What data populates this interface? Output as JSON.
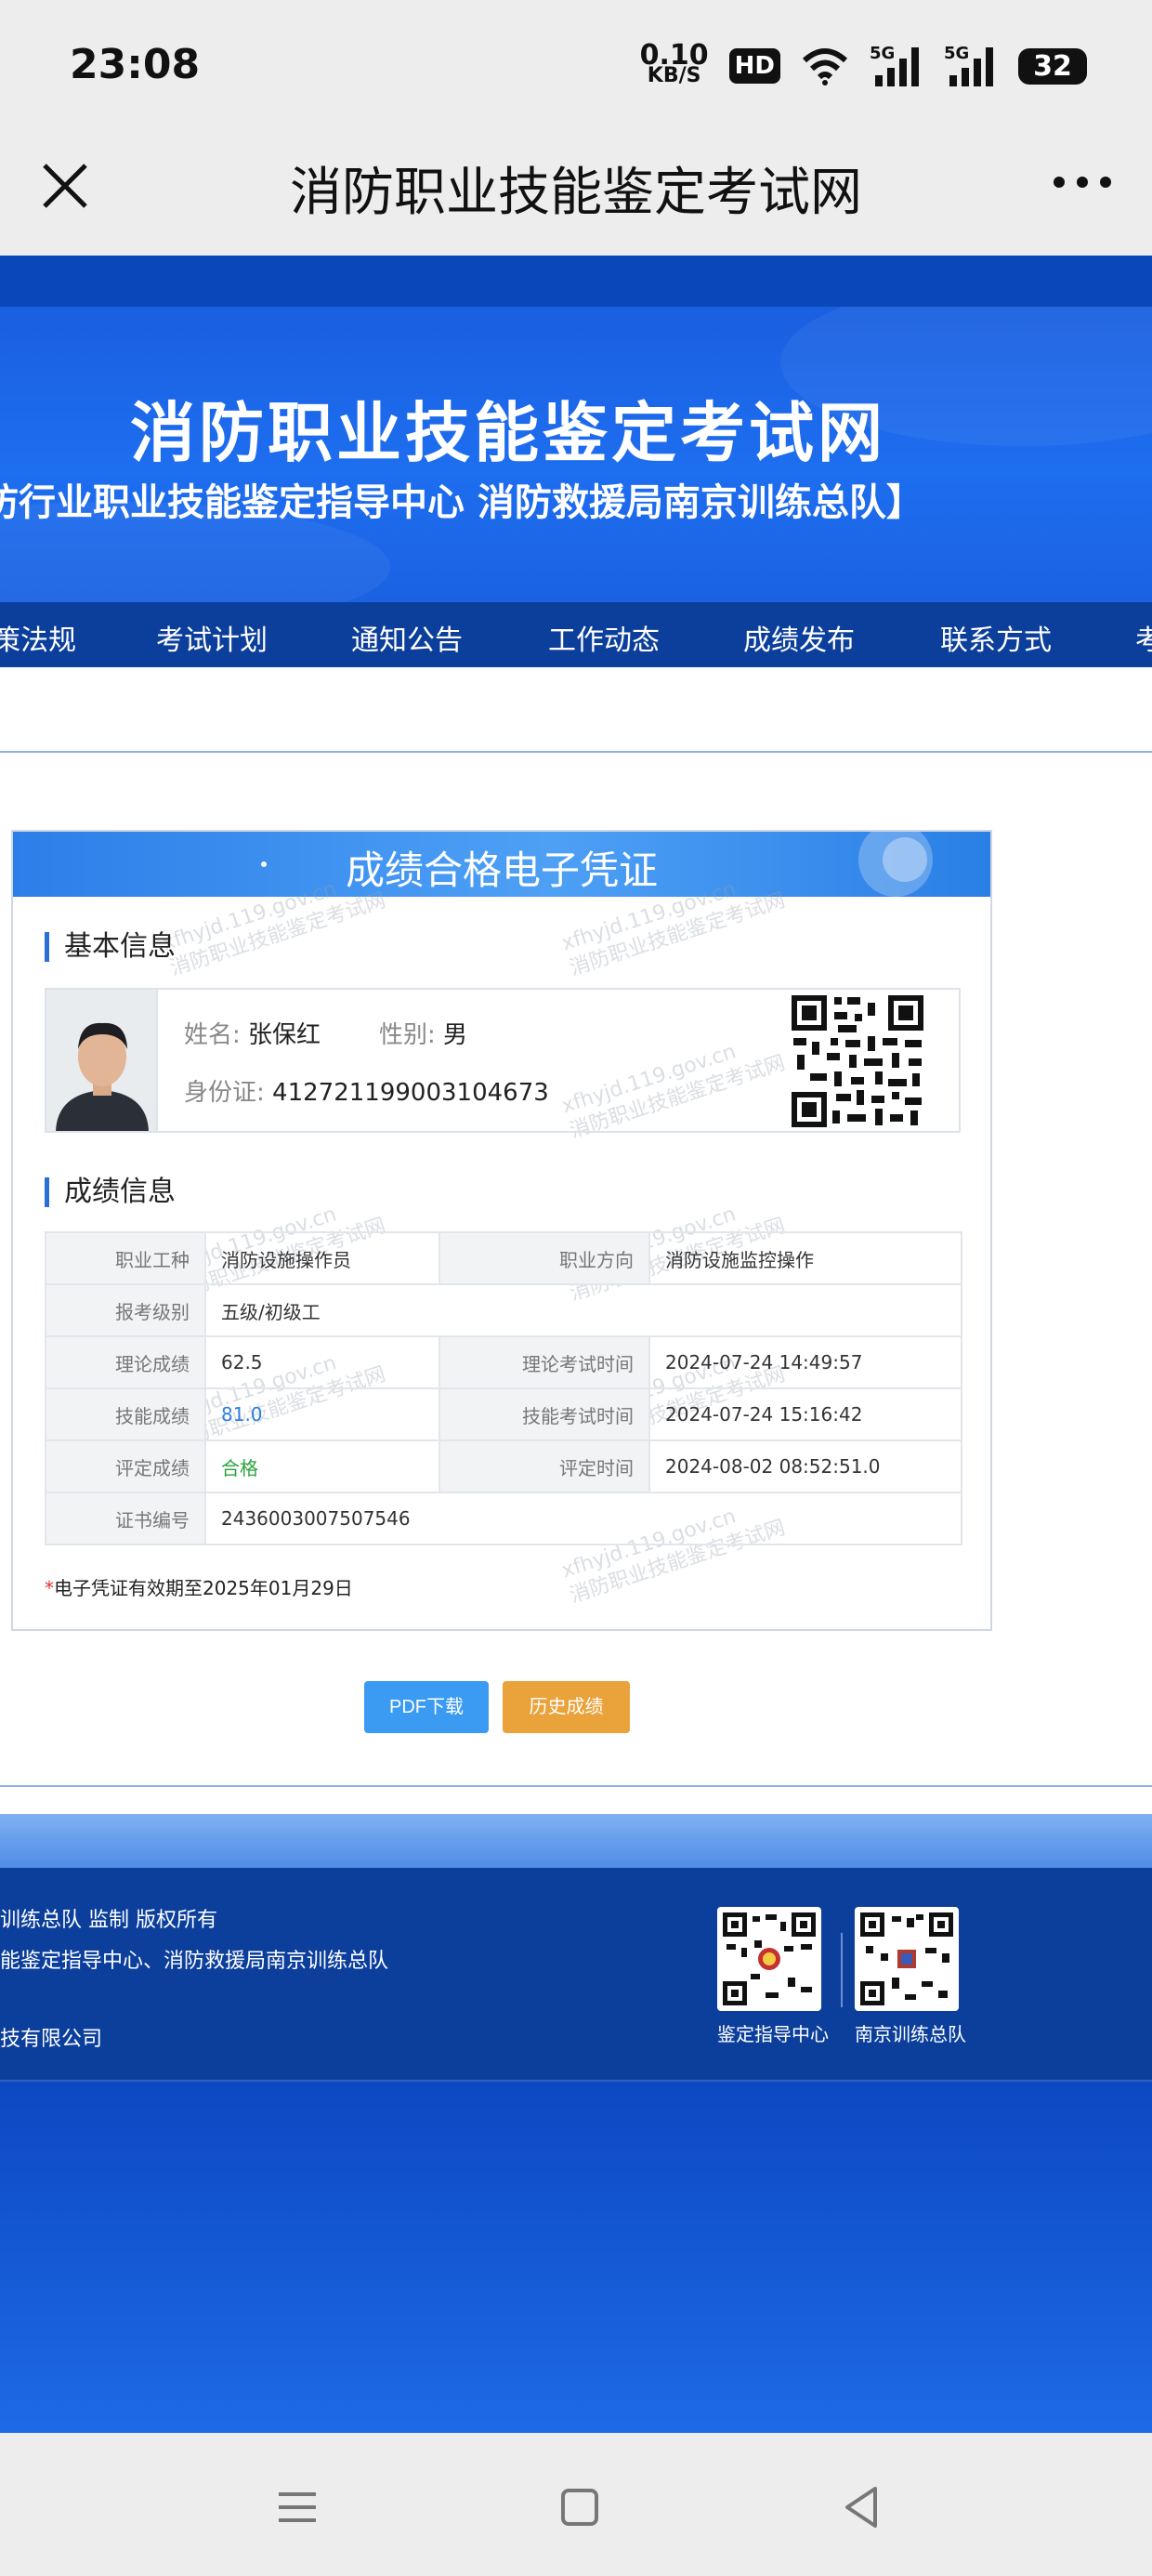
{
  "status_bar": {
    "time": "23:08",
    "net_speed_value": "0.10",
    "net_speed_unit": "KB/S",
    "hd_label": "HD",
    "signal1_label": "5G",
    "signal2_label": "5G",
    "battery": "32"
  },
  "title_bar": {
    "title": "消防职业技能鉴定考试网",
    "close_icon": "close-icon",
    "more_icon": "more-icon"
  },
  "banner": {
    "title": "消防职业技能鉴定考试网",
    "subtitle": "防行业职业技能鉴定指导中心        消防救援局南京训练总队】"
  },
  "nav": {
    "items": [
      "策法规",
      "考试计划",
      "通知公告",
      "工作动态",
      "成绩发布",
      "联系方式",
      "考"
    ]
  },
  "certificate": {
    "title": "成绩合格电子凭证",
    "basic_section": "基本信息",
    "name_label": "姓名:",
    "name": "张保红",
    "gender_label": "性别:",
    "gender": "男",
    "id_label": "身份证:",
    "id_number": "412721199003104673",
    "score_section": "成绩信息",
    "rows": {
      "job_type_label": "职业工种",
      "job_type": "消防设施操作员",
      "direction_label": "职业方向",
      "direction": "消防设施监控操作",
      "level_label": "报考级别",
      "level": "五级/初级工",
      "theory_label": "理论成绩",
      "theory": "62.5",
      "theory_time_label": "理论考试时间",
      "theory_time": "2024-07-24 14:49:57",
      "skill_label": "技能成绩",
      "skill": "81.0",
      "skill_time_label": "技能考试时间",
      "skill_time": "2024-07-24 15:16:42",
      "eval_label": "评定成绩",
      "eval": "合格",
      "eval_time_label": "评定时间",
      "eval_time": "2024-08-02 08:52:51.0",
      "cert_no_label": "证书编号",
      "cert_no": "2436003007507546"
    },
    "validity_star": "*",
    "validity": "电子凭证有效期至2025年01月29日",
    "watermark_line1": "xfhyjd.119.gov.cn",
    "watermark_line2": "消防职业技能鉴定考试网"
  },
  "buttons": {
    "pdf": "PDF下载",
    "history": "历史成绩"
  },
  "footer": {
    "line1": "训练总队 监制 版权所有",
    "line2": "能鉴定指导中心、消防救援局南京训练总队",
    "line3": "技有限公司",
    "qr1_label": "鉴定指导中心",
    "qr2_label": "南京训练总队"
  },
  "colors": {
    "banner_blue": "#1e6ef0",
    "nav_blue": "#0c3f9c",
    "pdf_button": "#3b9bf2",
    "history_button": "#eaa23a",
    "pass_green": "#2aa33c"
  }
}
